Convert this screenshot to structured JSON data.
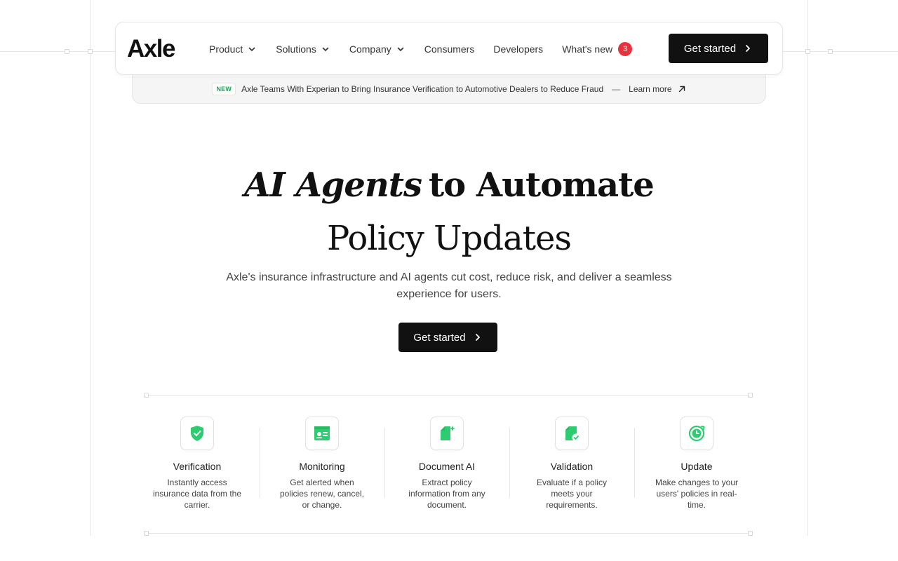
{
  "brand": {
    "logo": "Axle",
    "accent": "#2ecc71",
    "dark": "#111111",
    "badge_color": "#e8323c"
  },
  "nav": {
    "items": [
      {
        "label": "Product",
        "dropdown": true
      },
      {
        "label": "Solutions",
        "dropdown": true
      },
      {
        "label": "Company",
        "dropdown": true
      },
      {
        "label": "Consumers",
        "dropdown": false
      },
      {
        "label": "Developers",
        "dropdown": false
      },
      {
        "label": "What's new",
        "dropdown": false,
        "badge": "3"
      }
    ],
    "cta": "Get started"
  },
  "announcement": {
    "tag": "NEW",
    "text": "Axle Teams With Experian to Bring Insurance Verification to Automotive Dealers to Reduce Fraud",
    "separator": "—",
    "link": "Learn more"
  },
  "hero": {
    "title_italic": "AI Agents",
    "title_rest": "to Automate",
    "title_line2": "Policy Updates",
    "subtitle": "Axle's insurance infrastructure and AI agents cut cost, reduce risk, and deliver a seamless experience for users.",
    "cta": "Get started"
  },
  "features": [
    {
      "icon": "shield-check-icon",
      "title": "Verification",
      "desc": "Instantly access insurance data from the carrier."
    },
    {
      "icon": "id-card-icon",
      "title": "Monitoring",
      "desc": "Get alerted when policies renew, cancel, or change."
    },
    {
      "icon": "document-sparkle-icon",
      "title": "Document AI",
      "desc": "Extract policy information from any document."
    },
    {
      "icon": "document-check-icon",
      "title": "Validation",
      "desc": "Evaluate if a policy meets your requirements."
    },
    {
      "icon": "clock-refresh-icon",
      "title": "Update",
      "desc": "Make changes to your users' policies in real-time."
    }
  ]
}
